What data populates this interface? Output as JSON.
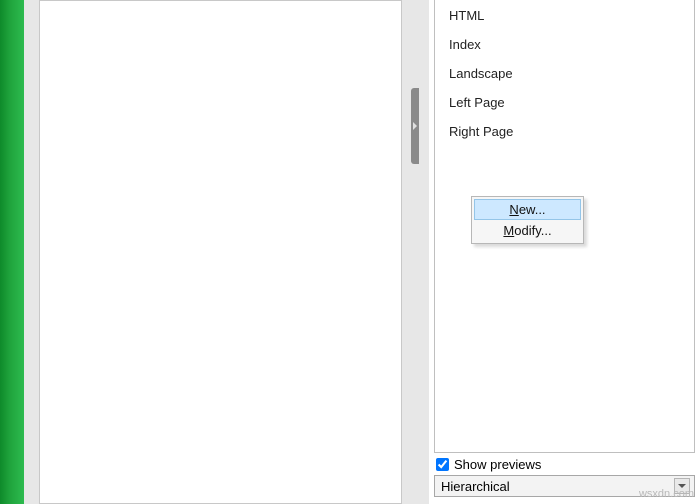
{
  "styles": {
    "items": [
      "HTML",
      "Index",
      "Landscape",
      "Left Page",
      "Right Page"
    ]
  },
  "context_menu": {
    "new_label": "New...",
    "new_accesskey": "N",
    "modify_label": "Modify...",
    "modify_accesskey": "M"
  },
  "panel": {
    "show_previews_label": "Show previews",
    "show_previews_checked": true,
    "dropdown_value": "Hierarchical"
  },
  "watermark": "wsxdn.com"
}
